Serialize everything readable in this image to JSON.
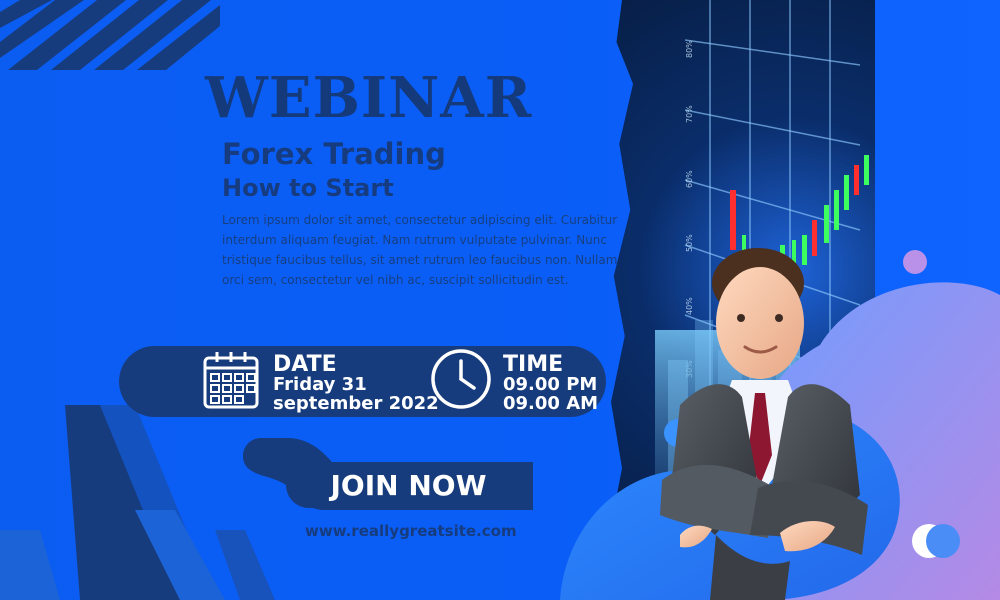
{
  "colors": {
    "background": "#0b5df2",
    "navy": "#173c7d",
    "white": "#ffffff",
    "accent_blue": "#2f8cff",
    "accent_purple": "#b08be5"
  },
  "icons": {
    "calendar": "calendar-icon",
    "clock": "clock-icon"
  },
  "hero": {
    "title": "WEBINAR",
    "subtitle": "Forex Trading",
    "subsubtitle": "How to Start",
    "description": "Lorem ipsum dolor sit amet, consectetur adipiscing elit. Curabitur interdum aliquam feugiat. Nam rutrum vulputate pulvinar. Nunc tristique faucibus tellus, sit amet rutrum leo faucibus non. Nullam orci sem, consectetur vel nibh ac, suscipit sollicitudin est."
  },
  "event": {
    "date_label": "DATE",
    "date_line1": "Friday 31",
    "date_line2": "september 2022",
    "time_label": "TIME",
    "time_line1": "09.00 PM",
    "time_line2": "09.00 AM"
  },
  "cta": {
    "join_label": "JOIN NOW",
    "url": "www.reallygreatsite.com"
  }
}
